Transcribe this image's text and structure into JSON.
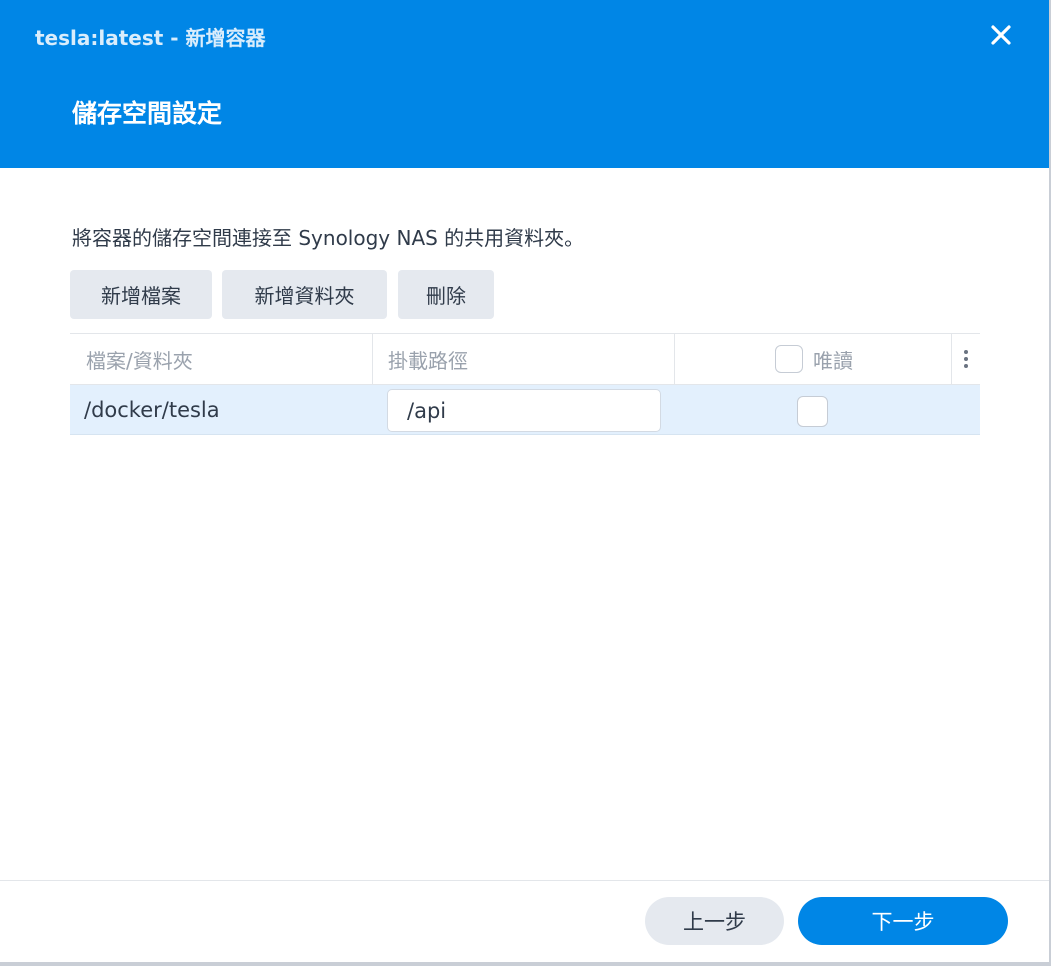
{
  "window": {
    "title": "tesla:latest - 新增容器",
    "close_icon": "close-icon"
  },
  "header": {
    "step_title": "儲存空間設定",
    "accent_color": "#0086e6"
  },
  "description": "將容器的儲存空間連接至 Synology NAS 的共用資料夾。",
  "toolbar": {
    "add_file_label": "新增檔案",
    "add_folder_label": "新增資料夾",
    "delete_label": "刪除"
  },
  "grid": {
    "columns": {
      "file_folder": "檔案/資料夾",
      "mount_path": "掛載路徑",
      "read_only": "唯讀"
    },
    "header_readonly_checked": false,
    "menu_icon": "kebab-menu-icon",
    "rows": [
      {
        "file_folder": "/docker/tesla",
        "mount_path": "/api",
        "read_only": false
      }
    ]
  },
  "footer": {
    "prev_label": "上一步",
    "next_label": "下一步"
  }
}
